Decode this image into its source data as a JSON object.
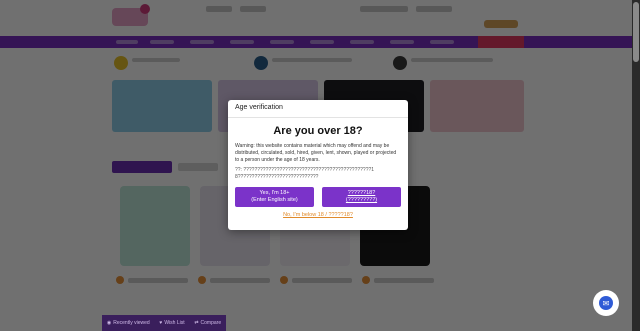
{
  "modal": {
    "header": "Age verification",
    "title": "Are you over 18?",
    "warning_en": "Warning: this website contains material which may offend and may be distributed, circulated, sold, hired, given, lent, shown, played or projected to a person under the age of 18 years.",
    "warning_alt": "??: ??????????????????????????????????????????????18?????????????????????????????",
    "buttons": {
      "yes_line1": "Yes, I'm 18+",
      "yes_line2": "(Enter English site)",
      "yes_alt_line1": "??????18?",
      "yes_alt_line2": "(?????????)"
    },
    "below_link": "No, I'm below 18 / ?????18?"
  },
  "bottom_bar": {
    "recently_viewed": "Recently viewed",
    "wish_list": "Wish List",
    "compare": "Compare"
  },
  "icons": {
    "recently_viewed": "eye-icon",
    "wish_list": "heart-icon",
    "compare": "compare-icon",
    "chat": "chat-icon"
  },
  "colors": {
    "primary_purple": "#7b33c9",
    "nav_purple": "#7a2fc1",
    "link_orange": "#e08a2a",
    "chat_blue": "#2f5bd6"
  }
}
